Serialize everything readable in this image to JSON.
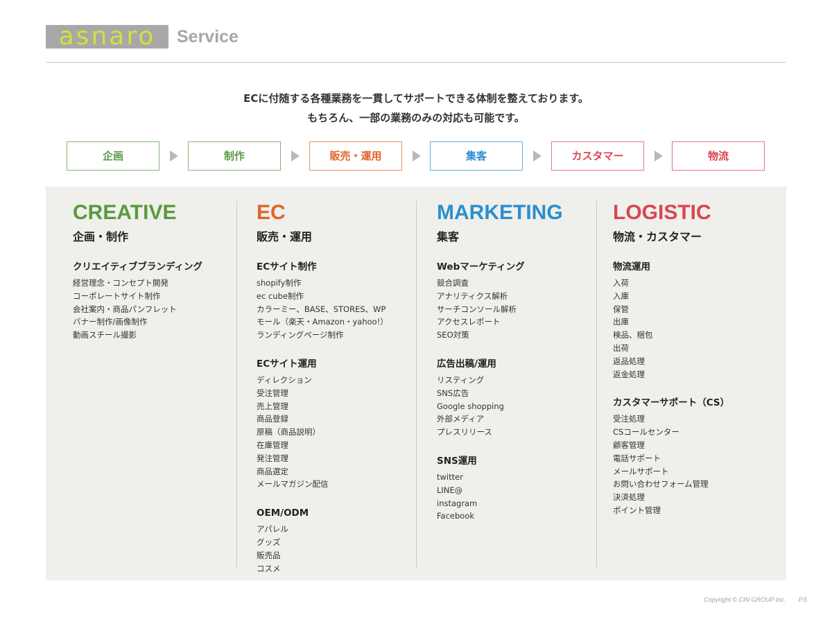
{
  "header": {
    "logo_text": "asnaro",
    "title": "Service"
  },
  "intro": {
    "line1": "ECに付随する各種業務を一貫してサポートできる体制を整えております。",
    "line2": "もちろん、一部の業務のみの対応も可能です。"
  },
  "flow": [
    {
      "label": "企画",
      "color": "#5a9a4a"
    },
    {
      "label": "制作",
      "color": "#5a9a4a"
    },
    {
      "label": "販売・運用",
      "color": "#e0652a"
    },
    {
      "label": "集客",
      "color": "#2b8fcf"
    },
    {
      "label": "カスタマー",
      "color": "#d9454f"
    },
    {
      "label": "物流",
      "color": "#d9454f"
    }
  ],
  "columns": [
    {
      "title": "CREATIVE",
      "subtitle": "企画・制作",
      "color": "#5a9a3c",
      "groups": [
        {
          "title": "クリエイティブブランディング",
          "items": [
            "経営理念・コンセプト開発",
            "コーポレートサイト制作",
            "会社案内・商品パンフレット",
            "バナー制作/画像制作",
            "動画スチール撮影"
          ]
        }
      ]
    },
    {
      "title": "EC",
      "subtitle": "販売・運用",
      "color": "#e0652a",
      "groups": [
        {
          "title": "ECサイト制作",
          "items": [
            "shopify制作",
            "ec cube制作",
            "カラーミー、BASE、STORES、WP",
            "モール（楽天・Amazon・yahoo!）",
            "ランディングページ制作"
          ]
        },
        {
          "title": "ECサイト運用",
          "items": [
            "ディレクション",
            "受注管理",
            "売上管理",
            "商品登録",
            "原稿（商品説明）",
            "在庫管理",
            "発注管理",
            "商品選定",
            "メールマガジン配信"
          ]
        },
        {
          "title": "OEM/ODM",
          "items": [
            "アパレル",
            "グッズ",
            "販売品",
            "コスメ"
          ]
        }
      ]
    },
    {
      "title": "MARKETING",
      "subtitle": "集客",
      "color": "#2b8fcf",
      "groups": [
        {
          "title": "Webマーケティング",
          "items": [
            "競合調査",
            "アナリティクス解析",
            "サーチコンソール解析",
            "アクセスレポート",
            "SEO対策"
          ]
        },
        {
          "title": "広告出稿/運用",
          "items": [
            "リスティング",
            "SNS広告",
            "Google shopping",
            "外部メディア",
            "プレスリリース"
          ]
        },
        {
          "title": "SNS運用",
          "items": [
            "twitter",
            "LINE@",
            "instagram",
            "Facebook"
          ]
        }
      ]
    },
    {
      "title": "LOGISTIC",
      "subtitle": "物流・カスタマー",
      "color": "#d9454f",
      "groups": [
        {
          "title": "物流運用",
          "items": [
            "入荷",
            "入庫",
            "保管",
            "出庫",
            "検品、梱包",
            "出荷",
            "返品処理",
            "返金処理"
          ]
        },
        {
          "title": "カスタマーサポート（CS）",
          "items": [
            "受注処理",
            "CSコールセンター",
            "顧客管理",
            "電話サポート",
            "メールサポート",
            "お問い合わせフォーム管理",
            "決済処理",
            "ポイント管理"
          ]
        }
      ]
    }
  ],
  "footer": {
    "copyright": "Copyright © CIN GROUP Inc.",
    "page": "P.5"
  }
}
